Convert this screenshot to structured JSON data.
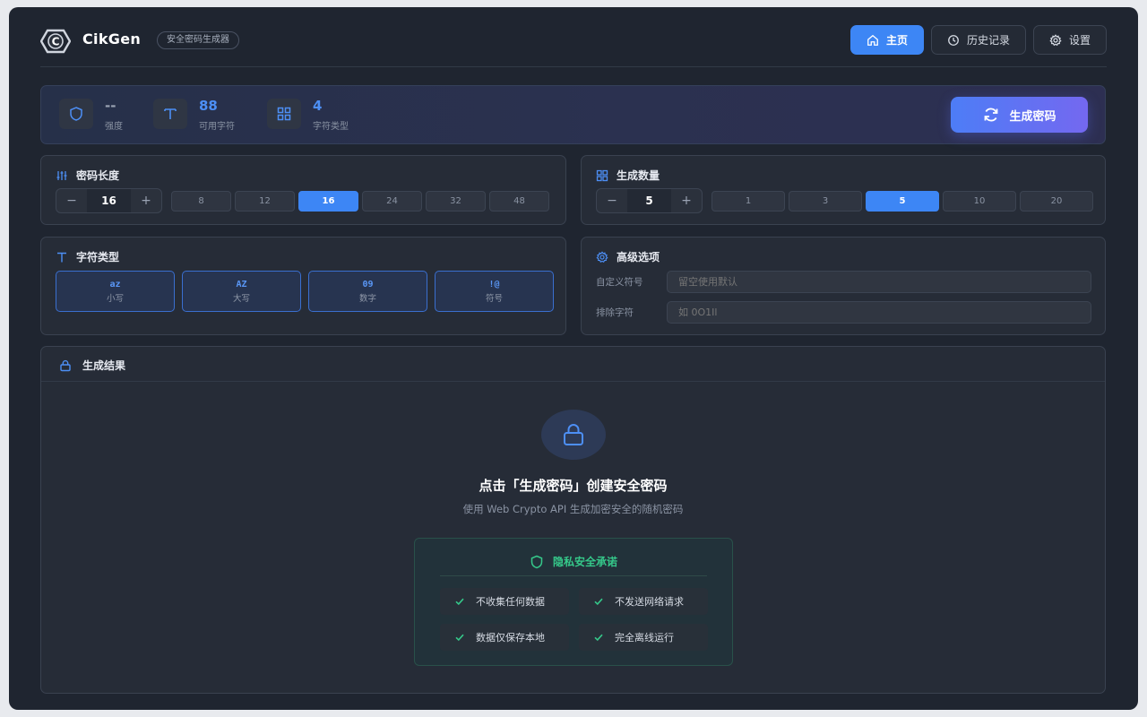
{
  "header": {
    "app_name": "CikGen",
    "app_tag": "安全密码生成器",
    "nav": [
      {
        "label": "主页",
        "icon": "home-icon",
        "active": true
      },
      {
        "label": "历史记录",
        "icon": "clock-icon",
        "active": false
      },
      {
        "label": "设置",
        "icon": "gear-icon",
        "active": false
      }
    ]
  },
  "stats": [
    {
      "value": "--",
      "label": "强度",
      "icon": "shield-icon"
    },
    {
      "value": "88",
      "label": "可用字符",
      "icon": "type-icon"
    },
    {
      "value": "4",
      "label": "字符类型",
      "icon": "grid-icon"
    }
  ],
  "generate_label": "生成密码",
  "length_card": {
    "title": "密码长度",
    "minus": "−",
    "plus": "+",
    "value": "16",
    "presets": [
      "8",
      "12",
      "16",
      "24",
      "32",
      "48"
    ],
    "active": "16"
  },
  "count_card": {
    "title": "生成数量",
    "minus": "−",
    "plus": "+",
    "value": "5",
    "presets": [
      "1",
      "3",
      "5",
      "10",
      "20"
    ],
    "active": "5"
  },
  "charset_card": {
    "title": "字符类型",
    "types": [
      {
        "key": "az",
        "label": "小写"
      },
      {
        "key": "AZ",
        "label": "大写"
      },
      {
        "key": "09",
        "label": "数字"
      },
      {
        "key": "!@",
        "label": "符号"
      }
    ]
  },
  "advanced_card": {
    "title": "高级选项",
    "custom_symbols_label": "自定义符号",
    "custom_symbols_placeholder": "留空使用默认",
    "exclude_label": "排除字符",
    "exclude_placeholder": "如 0O1Il"
  },
  "result": {
    "title": "生成结果",
    "empty_title": "点击「生成密码」创建安全密码",
    "empty_sub": "使用 Web Crypto API 生成加密安全的随机密码",
    "privacy_title": "隐私安全承诺",
    "promises": [
      "不收集任何数据",
      "不发送网络请求",
      "数据仅保存本地",
      "完全离线运行"
    ]
  },
  "colors": {
    "accent": "#3d86f5",
    "success": "#35c88a",
    "background": "#1f2530"
  }
}
